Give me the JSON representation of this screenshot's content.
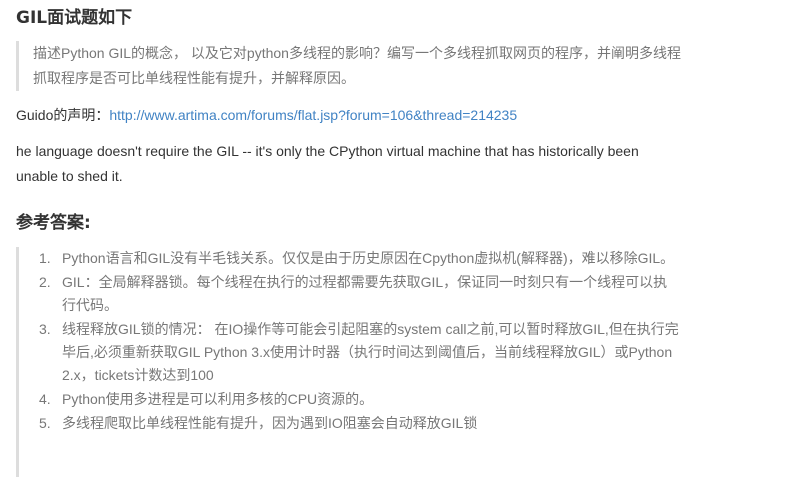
{
  "section1": {
    "title": "GIL面试题如下",
    "question": "描述Python GIL的概念， 以及它对python多线程的影响？编写一个多线程抓取网页的程序，并阐明多线程抓取程序是否可比单线程性能有提升，并解释原因。"
  },
  "guido": {
    "label": "Guido的声明：",
    "link_text": "http://www.artima.com/forums/flat.jsp?forum=106&thread=214235"
  },
  "english_quote": "he language doesn't require the GIL -- it's only the CPython virtual machine that has historically been unable to shed it.",
  "section2": {
    "title": "参考答案:",
    "items": [
      {
        "num": "1.",
        "text": "Python语言和GIL没有半毛钱关系。仅仅是由于历史原因在Cpython虚拟机(解释器)，难以移除GIL。"
      },
      {
        "num": "2.",
        "text": "GIL：全局解释器锁。每个线程在执行的过程都需要先获取GIL，保证同一时刻只有一个线程可以执行代码。"
      },
      {
        "num": "3.",
        "text": "线程释放GIL锁的情况： 在IO操作等可能会引起阻塞的system call之前,可以暂时释放GIL,但在执行完毕后,必须重新获取GIL Python 3.x使用计时器（执行时间达到阈值后，当前线程释放GIL）或Python 2.x，tickets计数达到100"
      },
      {
        "num": "4.",
        "text": "Python使用多进程是可以利用多核的CPU资源的。"
      },
      {
        "num": "5.",
        "text": "多线程爬取比单线程性能有提升，因为遇到IO阻塞会自动释放GIL锁"
      }
    ]
  }
}
